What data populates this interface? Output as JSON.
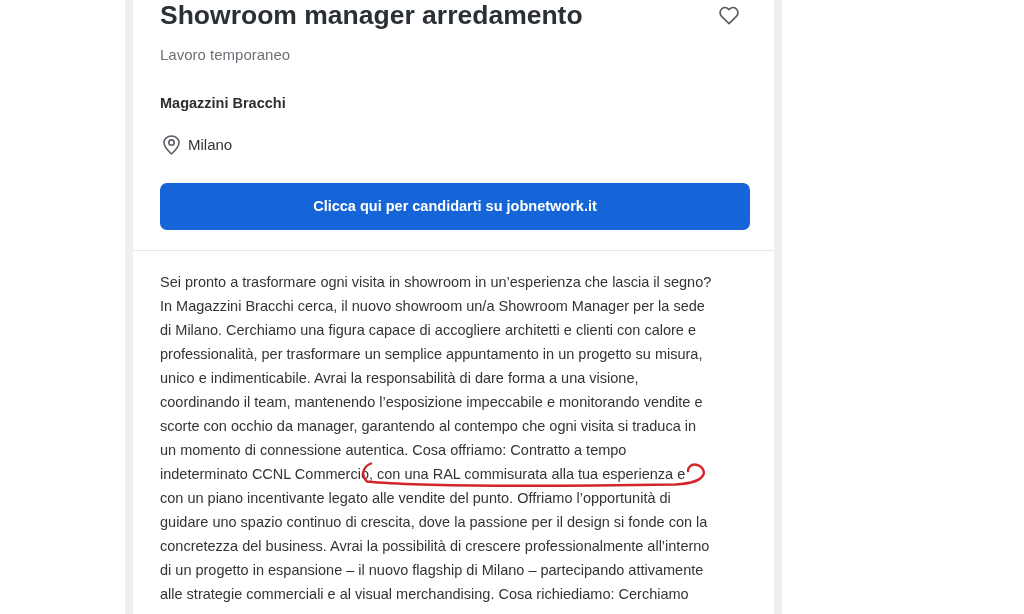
{
  "job": {
    "title": "Showroom manager arredamento",
    "saved": false,
    "contract_type": "Lavoro temporaneo",
    "company": "Magazzini Bracchi",
    "location": "Milano",
    "apply_button": "Clicca qui per candidarti su jobnetwork.it"
  },
  "description": {
    "segments": [
      {
        "text": "Sei pronto a trasformare ogni visita in showroom in un’esperienza che lascia il segno?\nIn Magazzini Bracchi cerca, il nuovo showroom un/a Showroom Manager per la sede\ndi Milano. Cerchiamo una figura capace di accogliere architetti e clienti con calore e\nprofessionalità, per trasformare un semplice appuntamento in un progetto su misura,\nunico e indimenticabile. Avrai la responsabilità di dare forma a una visione,\ncoordinando il team, mantenendo l’esposizione impeccabile e monitorando vendite e\nscorte con occhio da manager, garantendo al contempo che ogni visita si traduca in\nun momento di connessione autentica. Cosa offriamo: Contratto a tempo\nindeterminato CCNL Commercio",
        "marked": false
      },
      {
        "text": ", con una RAL commisurata alla tua esperienza e",
        "marked": true
      },
      {
        "text": "\ncon un piano incentivante legato alle vendite del punto. Offriamo l’opportunità di\nguidare uno spazio continuo di crescita, dove la passione per il design si fonde con la\nconcretezza del business. Avrai la possibilità di crescere professionalmente all’interno\ndi un progetto in espansione – il nuovo flagship di Milano – partecipando attivamente\nalle strategie commerciali e al visual merchandising. Cosa richiediamo: Cerchiamo",
        "marked": false
      }
    ]
  }
}
